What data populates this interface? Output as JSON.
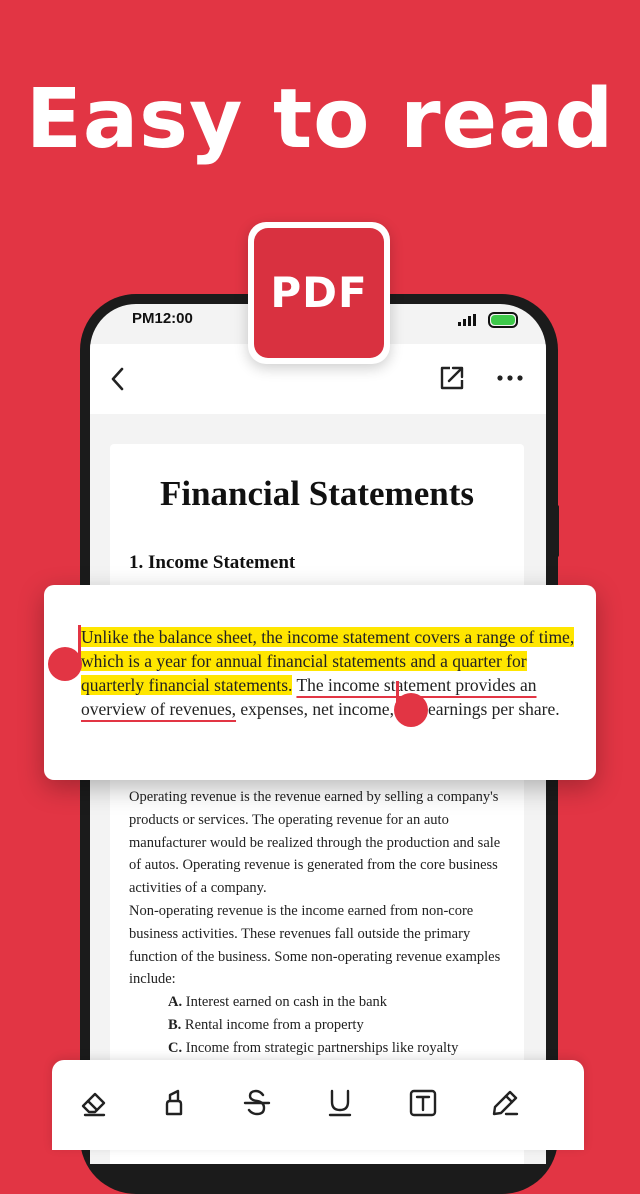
{
  "headline": "Easy to read",
  "badge": {
    "label": "PDF"
  },
  "status_bar": {
    "time": "PM12:00"
  },
  "document": {
    "title": "Financial Statements",
    "section": "1. Income Statement",
    "paragraphs": [
      "Operating revenue is the revenue earned by selling a company's products or services. The operating revenue for an auto manufacturer would be realized through the production and sale of autos. Operating revenue is generated from the core business activities of a company.",
      "Non-operating revenue is the income earned from non-core business activities. These revenues fall outside the primary function of the business. Some non-operating revenue examples include:"
    ],
    "list": [
      {
        "marker": "A.",
        "text": "Interest earned on cash in the bank"
      },
      {
        "marker": "B.",
        "text": "Rental income from a property"
      },
      {
        "marker": "C.",
        "text": "Income from strategic partnerships like royalty"
      }
    ]
  },
  "popup": {
    "highlighted_text": "Unlike the balance sheet, the income statement covers a range of time, which is a year for annual financial statements and a quarter for quarterly financial statements.",
    "underlined_text": "The income statement provides an overview of revenues,",
    "trailing_text": "expenses, net income, and earnings per share."
  },
  "toolbar": {
    "tools": [
      "eraser-icon",
      "highlighter-icon",
      "strikethrough-icon",
      "underline-icon",
      "text-box-icon",
      "pen-icon"
    ]
  },
  "colors": {
    "accent": "#e23544",
    "highlight": "#ffe600",
    "battery": "#3ec94a"
  }
}
